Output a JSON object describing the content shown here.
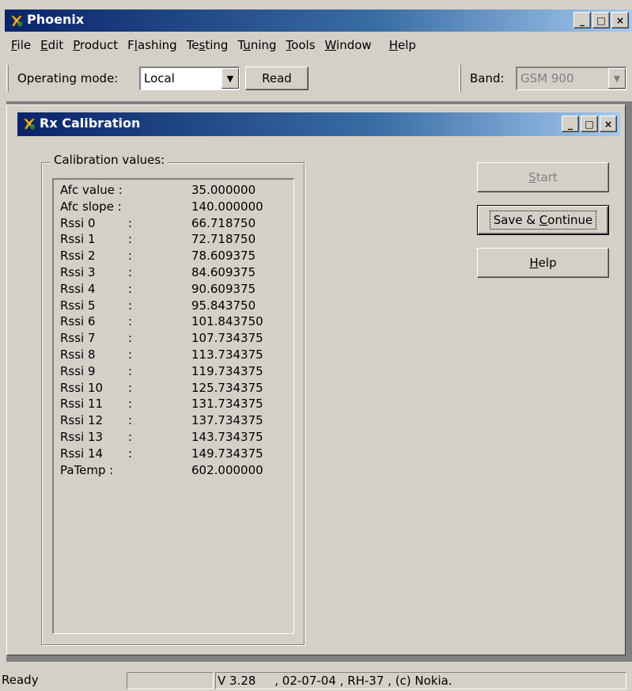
{
  "app": {
    "title": "Phoenix"
  },
  "window_buttons": {
    "minimize": "_",
    "maximize": "□",
    "close": "×"
  },
  "menu": [
    {
      "pre": "",
      "ul": "F",
      "post": "ile"
    },
    {
      "pre": "",
      "ul": "E",
      "post": "dit"
    },
    {
      "pre": "",
      "ul": "P",
      "post": "roduct"
    },
    {
      "pre": "F",
      "ul": "l",
      "post": "ashing"
    },
    {
      "pre": "Te",
      "ul": "s",
      "post": "ting"
    },
    {
      "pre": "T",
      "ul": "u",
      "post": "ning"
    },
    {
      "pre": "",
      "ul": "T",
      "post": "ools"
    },
    {
      "pre": "",
      "ul": "W",
      "post": "indow"
    },
    {
      "pre": "",
      "ul": "H",
      "post": "elp"
    }
  ],
  "toolbar": {
    "operating_mode_label": "Operating mode:",
    "operating_mode_value": "Local",
    "read_label": "Read",
    "band_label": "Band:",
    "band_value": "GSM 900"
  },
  "dialog": {
    "title": "Rx Calibration",
    "group_label": "Calibration values:",
    "rows": [
      {
        "key": "Afc value :",
        "colon": "",
        "value": "35.000000"
      },
      {
        "key": "Afc slope :",
        "colon": "",
        "value": "140.000000"
      },
      {
        "key": "Rssi 0",
        "colon": ":",
        "value": "66.718750"
      },
      {
        "key": "Rssi 1",
        "colon": ":",
        "value": "72.718750"
      },
      {
        "key": "Rssi 2",
        "colon": ":",
        "value": "78.609375"
      },
      {
        "key": "Rssi 3",
        "colon": ":",
        "value": "84.609375"
      },
      {
        "key": "Rssi 4",
        "colon": ":",
        "value": "90.609375"
      },
      {
        "key": "Rssi 5",
        "colon": ":",
        "value": "95.843750"
      },
      {
        "key": "Rssi 6",
        "colon": ":",
        "value": "101.843750"
      },
      {
        "key": "Rssi 7",
        "colon": ":",
        "value": "107.734375"
      },
      {
        "key": "Rssi 8",
        "colon": ":",
        "value": "113.734375"
      },
      {
        "key": "Rssi 9",
        "colon": ":",
        "value": "119.734375"
      },
      {
        "key": "Rssi 10",
        "colon": ":",
        "value": "125.734375"
      },
      {
        "key": "Rssi 11",
        "colon": ":",
        "value": "131.734375"
      },
      {
        "key": "Rssi 12",
        "colon": ":",
        "value": "137.734375"
      },
      {
        "key": "Rssi 13",
        "colon": ":",
        "value": "143.734375"
      },
      {
        "key": "Rssi 14",
        "colon": ":",
        "value": "149.734375"
      },
      {
        "key": "PaTemp :",
        "colon": "",
        "value": "602.000000"
      }
    ],
    "buttons": {
      "start": {
        "pre": "",
        "ul": "S",
        "post": "tart"
      },
      "save_continue": {
        "pre": "Save & ",
        "ul": "C",
        "post": "ontinue"
      },
      "help": {
        "pre": "",
        "ul": "H",
        "post": "elp"
      }
    }
  },
  "status": {
    "ready": "Ready",
    "empty": "",
    "version": "V 3.28     , 02-07-04 , RH-37 , (c) Nokia."
  }
}
